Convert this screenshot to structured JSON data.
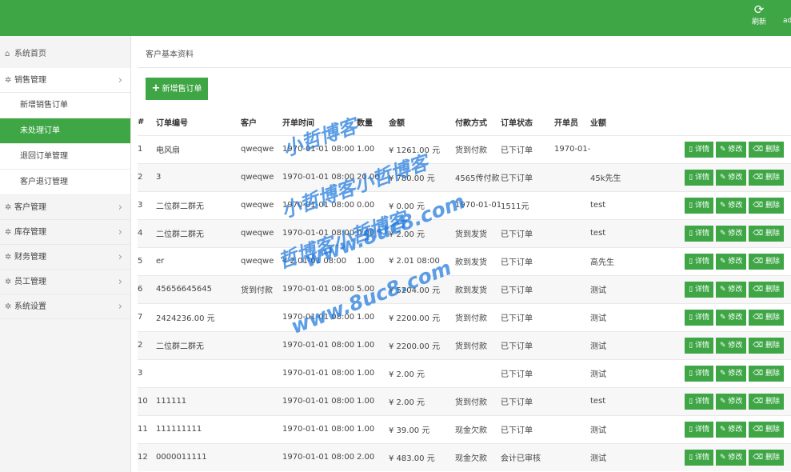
{
  "header": {
    "refresh_label": "刷新",
    "user_label": "ad"
  },
  "sidebar": {
    "home": "系统首页",
    "sales": {
      "label": "销售管理",
      "items": [
        "新增销售订单",
        "未处理订单",
        "退回订单管理",
        "客户退订管理"
      ]
    },
    "menus": [
      "客户管理",
      "库存管理",
      "财务管理",
      "员工管理",
      "系统设置"
    ]
  },
  "main": {
    "title": "客户基本资料",
    "add_button": "新增售订单",
    "columns": [
      "#",
      "订单编号",
      "客户",
      "开单时间",
      "数量",
      "金额",
      "付款方式",
      "订单状态",
      "开单员",
      "业额"
    ],
    "rows": [
      [
        "1",
        "电风扇",
        "qweqwe",
        "1970-01-01 08:00",
        "1.00",
        "¥ 1261.00 元",
        "货到付款",
        "已下订单",
        "1970-01-01 08:08:00",
        ""
      ],
      [
        "2",
        "3",
        "qweqwe",
        "1970-01-01 08:00",
        "20.00",
        "¥ 780.00 元",
        "4565传付款",
        "已下订单",
        "",
        "45k先生"
      ],
      [
        "3",
        "二位群二群无",
        "qweqwe",
        "1970-01-01 08:00",
        "0.00",
        "¥ 0.00 元",
        "1970-01-01 08:00",
        "1511元",
        "",
        "test"
      ],
      [
        "4",
        "二位群二群无",
        "qweqwe",
        "1970-01-01 08:00",
        "0.00",
        "¥ 2.00 元",
        "货到发货",
        "已下订单",
        "",
        "test"
      ],
      [
        "5",
        "er",
        "qweqwe",
        "¥ 2.01-01 08:00",
        "1.00",
        "¥ 2.01 08:00",
        "款到发货",
        "已下订单",
        "",
        "高先生"
      ],
      [
        "6",
        "45656645645",
        "货到付款",
        "1970-01-01 08:00",
        "5.00",
        "¥ 5204.00 元",
        "款到发货",
        "已下订单",
        "",
        "测试"
      ],
      [
        "7",
        "2424236.00 元",
        "",
        "1970-01-01 08:00",
        "1.00",
        "¥ 2200.00 元",
        "货到付款",
        "已下订单",
        "",
        "测试"
      ],
      [
        "2",
        "二位群二群无",
        "",
        "1970-01-01 08:00",
        "1.00",
        "¥ 2200.00 元",
        "货到付款",
        "已下订单",
        "",
        "测试"
      ],
      [
        "3",
        "",
        "",
        "1970-01-01 08:00",
        "1.00",
        "¥ 2.00 元",
        "",
        "已下订单",
        "",
        "测试"
      ],
      [
        "10",
        "111111",
        "",
        "1970-01-01 08:00",
        "1.00",
        "¥ 2.00 元",
        "货到付款",
        "已下订单",
        "",
        "test"
      ],
      [
        "11",
        "111111111",
        "",
        "1970-01-01 08:00",
        "1.00",
        "¥ 39.00 元",
        "现金欠款",
        "已下订单",
        "",
        "测试"
      ],
      [
        "12",
        "0000011111",
        "",
        "1970-01-01 08:00",
        "2.00",
        "¥ 483.00 元",
        "现金欠款",
        "会计已审核",
        "",
        "测试"
      ]
    ],
    "actions": {
      "detail": "详情",
      "edit": "修改",
      "delete": "删除"
    }
  },
  "watermark": {
    "line1": "小哲博客",
    "line2": "小哲博客小哲博客",
    "line3": "哲博客小哲博客",
    "url": "www.8uc8.com"
  },
  "colors": {
    "accent": "#3fa646",
    "watermark": "#1e78dc"
  },
  "icons": {
    "refresh": "refresh-icon",
    "home": "home-icon",
    "menu": "gear-icon",
    "chevron": "chevron-right-icon",
    "add": "plus-icon"
  }
}
